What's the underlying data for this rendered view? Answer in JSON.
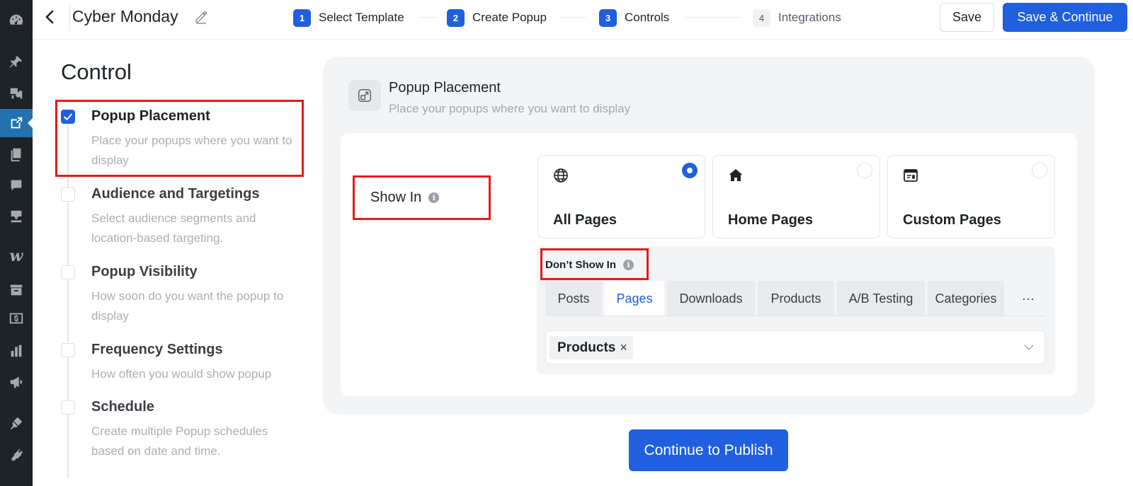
{
  "colors": {
    "accent": "#1f5fe0",
    "highlight_box": "#e31b1b",
    "wp_sidebar": "#1d2327",
    "wp_active": "#2271b1"
  },
  "wp_sidebar": {
    "icons": [
      "dashboard-icon",
      "pin-icon",
      "media-icon",
      "popup-icon",
      "pages-icon",
      "comments-icon",
      "download-icon",
      "woo-icon",
      "archive-icon",
      "dollar-icon",
      "chart-icon",
      "megaphone-icon",
      "brush-icon",
      "plugin-icon"
    ],
    "woo_letter": "w"
  },
  "header": {
    "title": "Cyber Monday",
    "steps": [
      {
        "num": "1",
        "label": "Select Template"
      },
      {
        "num": "2",
        "label": "Create Popup"
      },
      {
        "num": "3",
        "label": "Controls"
      },
      {
        "num": "4",
        "label": "Integrations"
      }
    ],
    "save_label": "Save",
    "save_continue_label": "Save & Continue"
  },
  "control": {
    "heading": "Control",
    "items": [
      {
        "title": "Popup Placement",
        "desc": "Place your popups where you want to display",
        "checked": true
      },
      {
        "title": "Audience and Targetings",
        "desc": "Select audience segments and location-based targeting.",
        "checked": false
      },
      {
        "title": "Popup Visibility",
        "desc": "How soon do you want the popup to display",
        "checked": false
      },
      {
        "title": "Frequency Settings",
        "desc": "How often you would show popup",
        "checked": false
      },
      {
        "title": "Schedule",
        "desc": "Create multiple Popup schedules based on date and time.",
        "checked": false
      }
    ]
  },
  "placement": {
    "title": "Popup Placement",
    "subtitle": "Place your popups where you want to display",
    "show_in_label": "Show In",
    "info_glyph": "i",
    "options": [
      {
        "label": "All Pages",
        "icon": "globe-icon",
        "selected": true
      },
      {
        "label": "Home Pages",
        "icon": "home-icon",
        "selected": false
      },
      {
        "label": "Custom Pages",
        "icon": "browser-window-icon",
        "selected": false
      }
    ],
    "dont_show_label": "Don’t Show In",
    "tabs": [
      "Posts",
      "Pages",
      "Downloads",
      "Products",
      "A/B Testing",
      "Categories"
    ],
    "active_tab": "Pages",
    "more_label": "···",
    "selected_chip": "Products",
    "chip_remove": "×"
  },
  "footer": {
    "publish_label": "Continue to Publish"
  }
}
